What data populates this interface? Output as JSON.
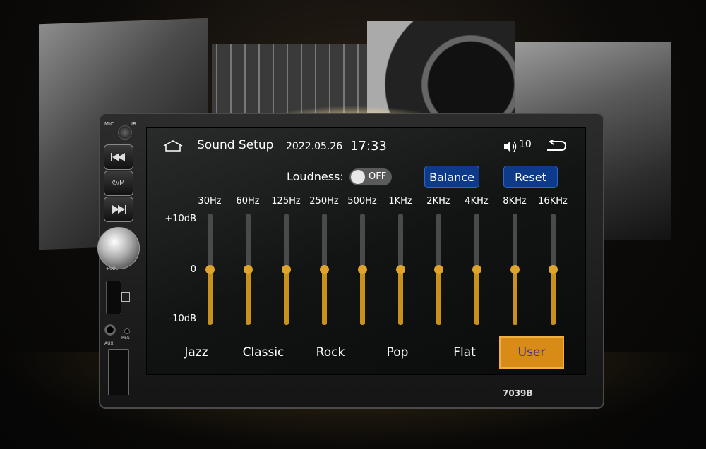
{
  "screen": {
    "title": "Sound Setup",
    "date": "2022.05.26",
    "time": "17:33",
    "volume": "10",
    "loudness_label": "Loudness:",
    "loudness_state": "OFF",
    "balance_label": "Balance",
    "reset_label": "Reset",
    "db_labels": [
      "+10dB",
      "0",
      "-10dB"
    ],
    "bands": [
      {
        "freq": "30Hz",
        "level": 0
      },
      {
        "freq": "60Hz",
        "level": 0
      },
      {
        "freq": "125Hz",
        "level": 0
      },
      {
        "freq": "250Hz",
        "level": 0
      },
      {
        "freq": "500Hz",
        "level": 0
      },
      {
        "freq": "1KHz",
        "level": 0
      },
      {
        "freq": "2KHz",
        "level": 0
      },
      {
        "freq": "4KHz",
        "level": 0
      },
      {
        "freq": "8KHz",
        "level": 0
      },
      {
        "freq": "16KHz",
        "level": 0
      }
    ],
    "level_range": [
      -10,
      10
    ],
    "presets": [
      "Jazz",
      "Classic",
      "Rock",
      "Pop",
      "Flat",
      "User"
    ],
    "active_preset": "User"
  },
  "device": {
    "mic_label": "MIC",
    "ir_label": "IR",
    "mode_label": "⏻/M",
    "vol_label": "+VOL-",
    "aux_label": "AUX",
    "res_label": "RES",
    "model": "7039B"
  },
  "colors": {
    "accent": "#d98b17",
    "slider_fill": "#c8901c",
    "button_blue": "#0d3b8a"
  },
  "icons": [
    "home-icon",
    "volume-icon",
    "back-icon",
    "prev-track-icon",
    "next-track-icon",
    "sd-card-icon"
  ]
}
